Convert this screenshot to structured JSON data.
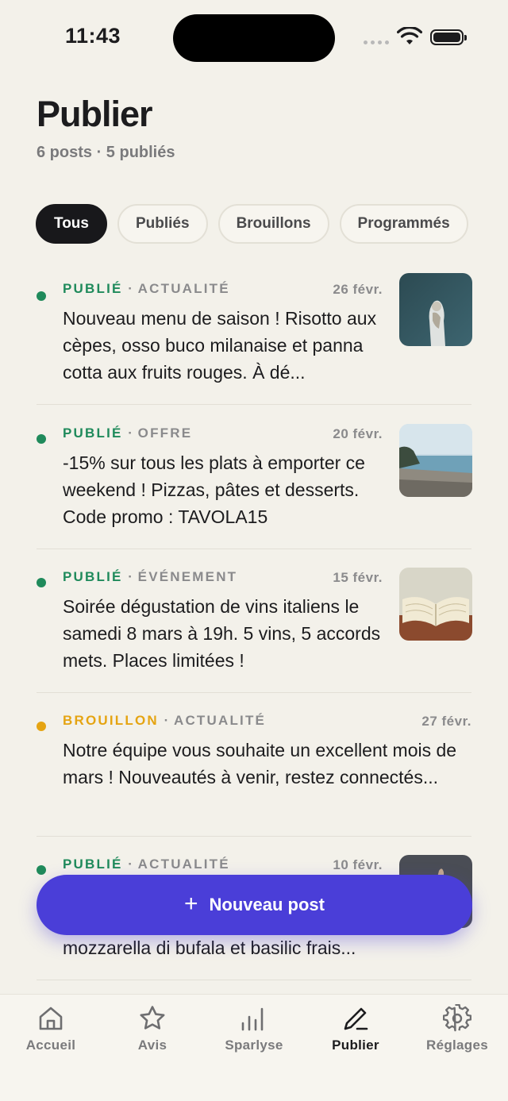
{
  "status_bar": {
    "time": "11:43"
  },
  "header": {
    "title": "Publier",
    "subtitle": "6 posts · 5 publiés"
  },
  "filters": [
    {
      "label": "Tous",
      "active": true
    },
    {
      "label": "Publiés",
      "active": false
    },
    {
      "label": "Brouillons",
      "active": false
    },
    {
      "label": "Programmés",
      "active": false
    }
  ],
  "posts": [
    {
      "status": "PUBLIÉ",
      "category": "ACTUALITÉ",
      "date": "26 févr.",
      "text": "Nouveau menu de saison ! Risotto aux cèpes, osso buco milanaise et panna cotta aux fruits rouges. À dé...",
      "status_color": "#1f8a5b",
      "thumb": "statue"
    },
    {
      "status": "PUBLIÉ",
      "category": "OFFRE",
      "date": "20 févr.",
      "text": "-15% sur tous les plats à emporter ce weekend ! Pizzas, pâtes et desserts. Code promo : TAVOLA15",
      "status_color": "#1f8a5b",
      "thumb": "beach"
    },
    {
      "status": "PUBLIÉ",
      "category": "ÉVÉNEMENT",
      "date": "15 févr.",
      "text": "Soirée dégustation de vins italiens le samedi 8 mars à 19h. 5 vins, 5 accords mets. Places limitées !",
      "status_color": "#1f8a5b",
      "thumb": "book"
    },
    {
      "status": "BROUILLON",
      "category": "ACTUALITÉ",
      "date": "27 févr.",
      "text": "Notre équipe vous souhaite un excellent mois de mars ! Nouveautés à venir, restez connectés...",
      "status_color": "#e5a412",
      "thumb": ""
    },
    {
      "status": "PUBLIÉ",
      "category": "ACTUALITÉ",
      "date": "10 févr.",
      "text": "mozzarella di bufala et basilic frais...",
      "status_color": "#1f8a5b",
      "thumb": "hand"
    }
  ],
  "fab": {
    "plus": "+",
    "label": "Nouveau post"
  },
  "tabbar": [
    {
      "label": "Accueil",
      "icon": "home-icon",
      "active": false
    },
    {
      "label": "Avis",
      "icon": "star-icon",
      "active": false
    },
    {
      "label": "Sparlyse",
      "icon": "bar-chart-icon",
      "active": false
    },
    {
      "label": "Publier",
      "icon": "pen-icon",
      "active": true
    },
    {
      "label": "Réglages",
      "icon": "gear-icon",
      "active": false
    }
  ]
}
